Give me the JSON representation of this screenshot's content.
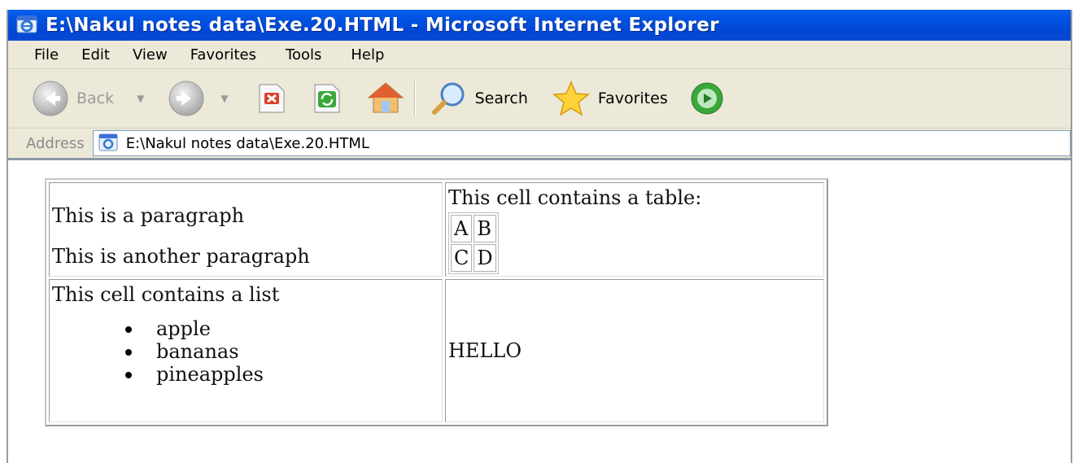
{
  "window": {
    "title": "E:\\Nakul notes data\\Exe.20.HTML - Microsoft Internet Explorer",
    "icon": "ie-icon"
  },
  "menu": [
    "File",
    "Edit",
    "View",
    "Favorites",
    "Tools",
    "Help"
  ],
  "toolbar": {
    "back_label": "Back",
    "search_label": "Search",
    "favorites_label": "Favorites"
  },
  "address": {
    "label": "Address",
    "value": "E:\\Nakul notes data\\Exe.20.HTML"
  },
  "page": {
    "cell1": {
      "para1": "This is a paragraph",
      "para2": "This is another paragraph"
    },
    "cell2": {
      "heading": "This cell contains a table:",
      "inner_table": [
        [
          "A",
          "B"
        ],
        [
          "C",
          "D"
        ]
      ]
    },
    "cell3": {
      "heading": "This cell contains a list",
      "items": [
        "apple",
        "bananas",
        "pineapples"
      ]
    },
    "cell4": {
      "text": "HELLO"
    }
  },
  "colors": {
    "titlebar": "#0052e0",
    "chrome": "#ece9d8"
  }
}
